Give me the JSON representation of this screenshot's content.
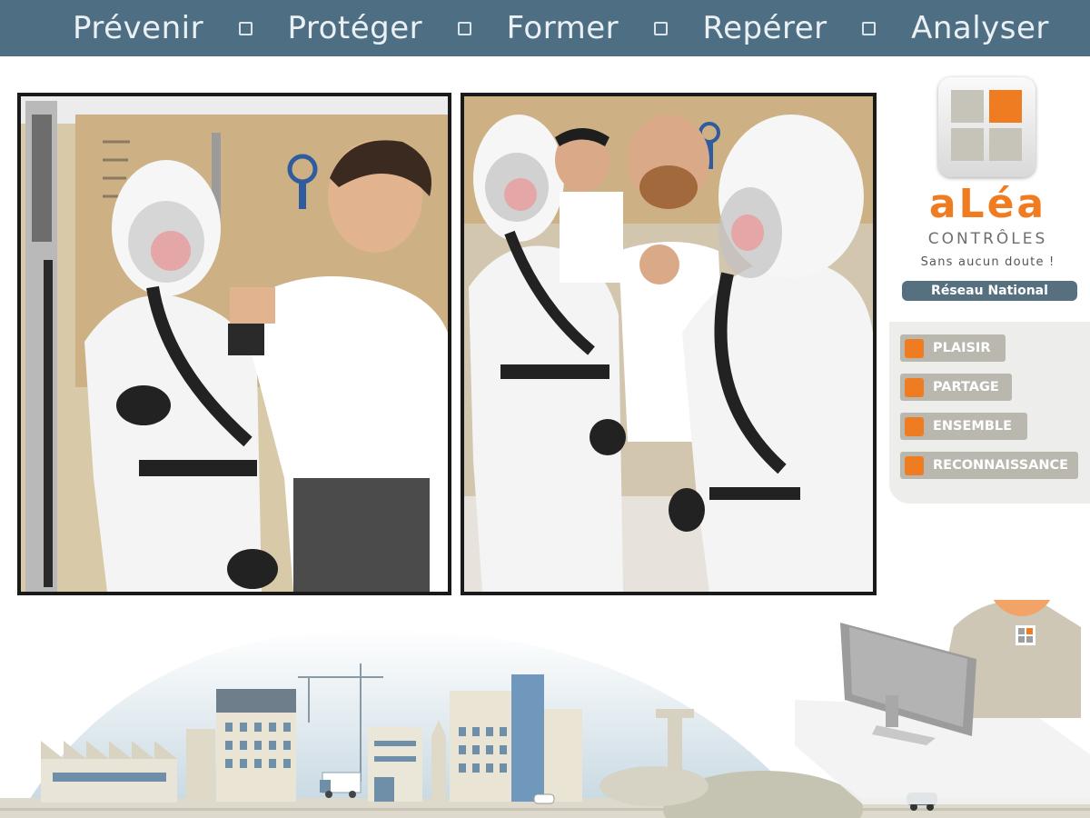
{
  "banner": {
    "items": [
      "Prévenir",
      "Protéger",
      "Former",
      "Repérer",
      "Analyser"
    ]
  },
  "brand": {
    "name": "aLéa",
    "subtitle": "CONTRÔLES",
    "tagline": "Sans aucun doute !",
    "network": "Réseau National"
  },
  "values": [
    "PLAISIR",
    "PARTAGE",
    "ENSEMBLE",
    "RECONNAISSANCE"
  ],
  "colors": {
    "banner": "#4e6f83",
    "accent": "#f07c22",
    "badge": "#56707f",
    "pill": "#b9b7ae"
  }
}
